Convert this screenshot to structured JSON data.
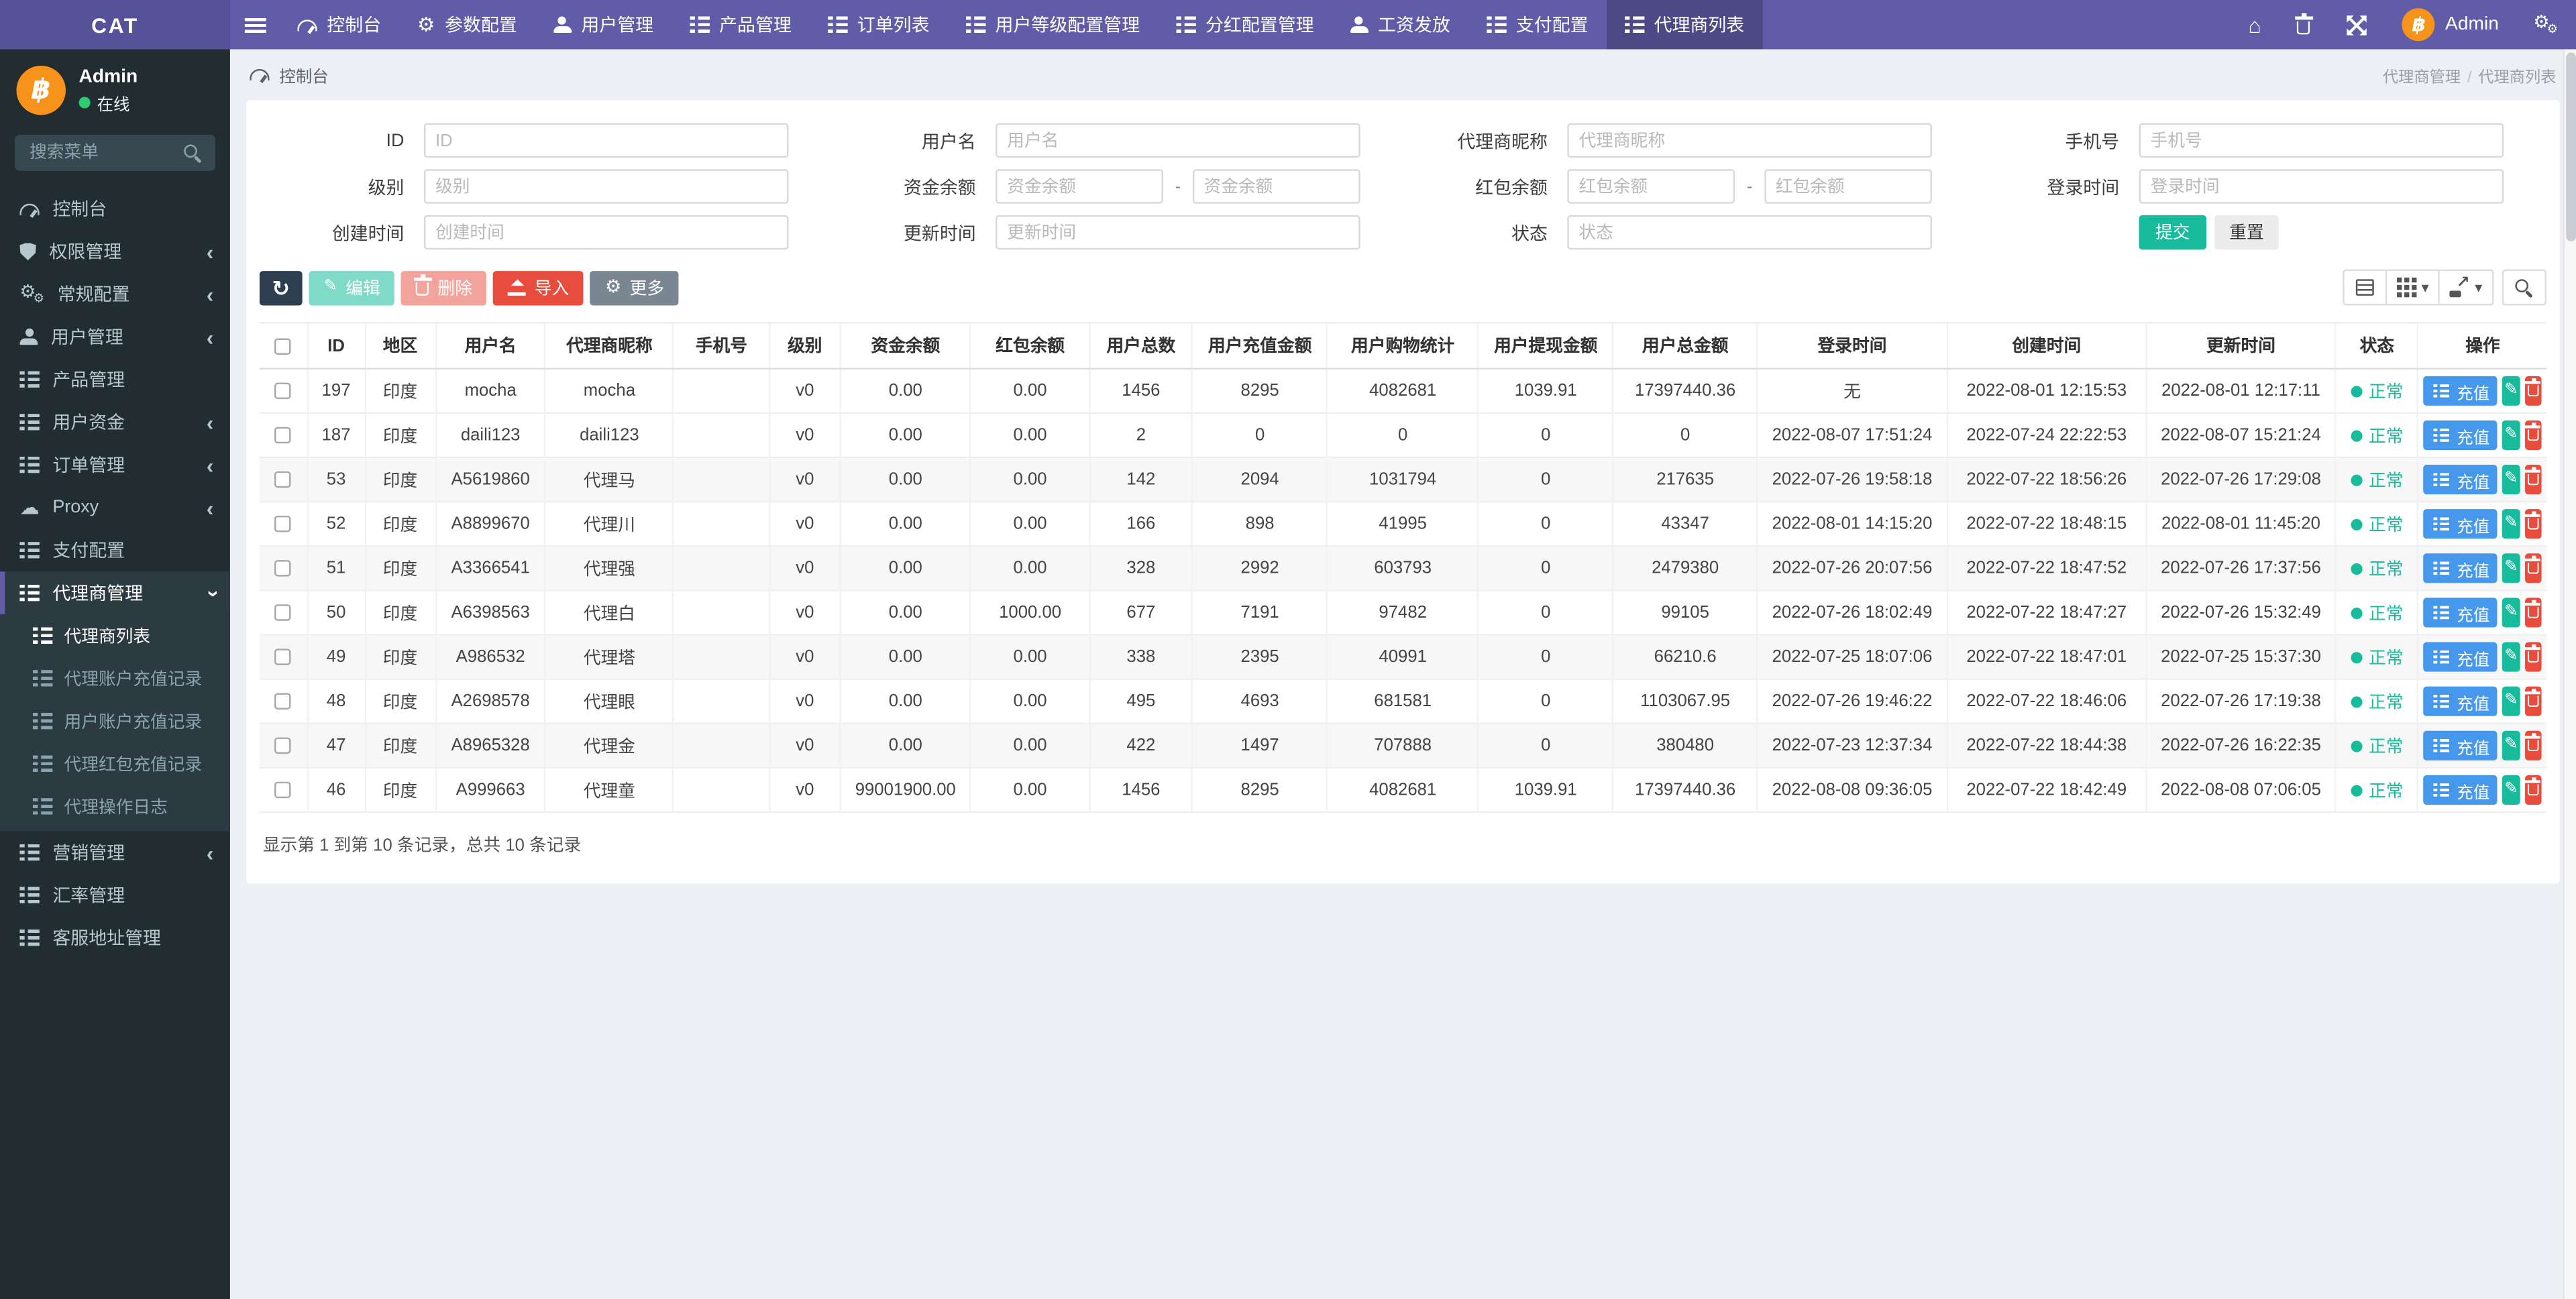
{
  "brand": "CAT",
  "colors": {
    "accent_purple": "#605ca8",
    "logo_purple": "#555299",
    "sidebar_dark": "#222d32",
    "content_bg": "#ecf0f5",
    "teal": "#18bc9c",
    "red": "#e74c3c",
    "blue": "#4598eb",
    "dark_navy": "#2c3e50",
    "avatar_orange": "#f7931a",
    "online_green": "#2ecc71"
  },
  "topnav": {
    "user_name": "Admin",
    "avatar_glyph": "฿",
    "items": [
      {
        "label": "控制台",
        "icon": "dashboard-icon"
      },
      {
        "label": "参数配置",
        "icon": "gear-icon"
      },
      {
        "label": "用户管理",
        "icon": "user-icon"
      },
      {
        "label": "产品管理",
        "icon": "list-icon"
      },
      {
        "label": "订单列表",
        "icon": "list-icon"
      },
      {
        "label": "用户等级配置管理",
        "icon": "list-icon"
      },
      {
        "label": "分红配置管理",
        "icon": "list-icon"
      },
      {
        "label": "工资发放",
        "icon": "user-icon"
      },
      {
        "label": "支付配置",
        "icon": "list-icon"
      },
      {
        "label": "代理商列表",
        "icon": "list-icon",
        "active": true
      }
    ]
  },
  "sidebar": {
    "user_name": "Admin",
    "avatar_glyph": "฿",
    "status_label": "在线",
    "search_placeholder": "搜索菜单",
    "menu": [
      {
        "label": "控制台",
        "icon": "dashboard-icon"
      },
      {
        "label": "权限管理",
        "icon": "shield-icon",
        "chevron": "left"
      },
      {
        "label": "常规配置",
        "icon": "cogs-icon",
        "chevron": "left"
      },
      {
        "label": "用户管理",
        "icon": "user-icon",
        "chevron": "left"
      },
      {
        "label": "产品管理",
        "icon": "list-icon"
      },
      {
        "label": "用户资金",
        "icon": "list-icon",
        "chevron": "left"
      },
      {
        "label": "订单管理",
        "icon": "list-icon",
        "chevron": "left"
      },
      {
        "label": "Proxy",
        "icon": "cloud-icon",
        "chevron": "left"
      },
      {
        "label": "支付配置",
        "icon": "list-icon"
      },
      {
        "label": "代理商管理",
        "icon": "list-icon",
        "chevron": "down",
        "active": true,
        "children": [
          {
            "label": "代理商列表",
            "active": true
          },
          {
            "label": "代理账户充值记录"
          },
          {
            "label": "用户账户充值记录"
          },
          {
            "label": "代理红包充值记录"
          },
          {
            "label": "代理操作日志"
          }
        ]
      },
      {
        "label": "营销管理",
        "icon": "list-icon",
        "chevron": "left"
      },
      {
        "label": "汇率管理",
        "icon": "list-icon"
      },
      {
        "label": "客服地址管理",
        "icon": "list-icon"
      }
    ]
  },
  "breadcrumb": {
    "home_label": "控制台",
    "separator": "/",
    "path": [
      "代理商管理",
      "代理商列表"
    ]
  },
  "filters": {
    "range_separator": "-",
    "submit_label": "提交",
    "reset_label": "重置",
    "fields": [
      {
        "label": "ID",
        "type": "text",
        "placeholder": "ID"
      },
      {
        "label": "用户名",
        "type": "text",
        "placeholder": "用户名"
      },
      {
        "label": "代理商昵称",
        "type": "text",
        "placeholder": "代理商昵称"
      },
      {
        "label": "手机号",
        "type": "text",
        "placeholder": "手机号"
      },
      {
        "label": "级别",
        "type": "text",
        "placeholder": "级别"
      },
      {
        "label": "资金余额",
        "type": "range",
        "placeholder_min": "资金余额",
        "placeholder_max": "资金余额"
      },
      {
        "label": "红包余额",
        "type": "range",
        "placeholder_min": "红包余额",
        "placeholder_max": "红包余额"
      },
      {
        "label": "登录时间",
        "type": "text",
        "placeholder": "登录时间"
      },
      {
        "label": "创建时间",
        "type": "text",
        "placeholder": "创建时间"
      },
      {
        "label": "更新时间",
        "type": "text",
        "placeholder": "更新时间"
      },
      {
        "label": "状态",
        "type": "text",
        "placeholder": "状态"
      }
    ]
  },
  "toolbar": {
    "edit_label": "编辑",
    "delete_label": "删除",
    "import_label": "导入",
    "more_label": "更多"
  },
  "table": {
    "recharge_label": "充值",
    "headers": [
      "ID",
      "地区",
      "用户名",
      "代理商昵称",
      "手机号",
      "级别",
      "资金余额",
      "红包余额",
      "用户总数",
      "用户充值金额",
      "用户购物统计",
      "用户提现金额",
      "用户总金额",
      "登录时间",
      "创建时间",
      "更新时间",
      "状态",
      "操作"
    ],
    "rows": [
      {
        "id": "197",
        "region": "印度",
        "username": "mocha",
        "nickname": "mocha",
        "phone": "",
        "level": "v0",
        "fund": "0.00",
        "red": "0.00",
        "users": "1456",
        "recharge": "8295",
        "shopping": "4082681",
        "withdraw": "1039.91",
        "total": "17397440.36",
        "login": "无",
        "created": "2022-08-01 12:15:53",
        "updated": "2022-08-01 12:17:11",
        "status": "正常"
      },
      {
        "id": "187",
        "region": "印度",
        "username": "daili123",
        "nickname": "daili123",
        "phone": "",
        "level": "v0",
        "fund": "0.00",
        "red": "0.00",
        "users": "2",
        "recharge": "0",
        "shopping": "0",
        "withdraw": "0",
        "total": "0",
        "login": "2022-08-07 17:51:24",
        "created": "2022-07-24 22:22:53",
        "updated": "2022-08-07 15:21:24",
        "status": "正常"
      },
      {
        "id": "53",
        "region": "印度",
        "username": "A5619860",
        "nickname": "代理马",
        "phone": "",
        "level": "v0",
        "fund": "0.00",
        "red": "0.00",
        "users": "142",
        "recharge": "2094",
        "shopping": "1031794",
        "withdraw": "0",
        "total": "217635",
        "login": "2022-07-26 19:58:18",
        "created": "2022-07-22 18:56:26",
        "updated": "2022-07-26 17:29:08",
        "status": "正常"
      },
      {
        "id": "52",
        "region": "印度",
        "username": "A8899670",
        "nickname": "代理川",
        "phone": "",
        "level": "v0",
        "fund": "0.00",
        "red": "0.00",
        "users": "166",
        "recharge": "898",
        "shopping": "41995",
        "withdraw": "0",
        "total": "43347",
        "login": "2022-08-01 14:15:20",
        "created": "2022-07-22 18:48:15",
        "updated": "2022-08-01 11:45:20",
        "status": "正常"
      },
      {
        "id": "51",
        "region": "印度",
        "username": "A3366541",
        "nickname": "代理强",
        "phone": "",
        "level": "v0",
        "fund": "0.00",
        "red": "0.00",
        "users": "328",
        "recharge": "2992",
        "shopping": "603793",
        "withdraw": "0",
        "total": "2479380",
        "login": "2022-07-26 20:07:56",
        "created": "2022-07-22 18:47:52",
        "updated": "2022-07-26 17:37:56",
        "status": "正常"
      },
      {
        "id": "50",
        "region": "印度",
        "username": "A6398563",
        "nickname": "代理白",
        "phone": "",
        "level": "v0",
        "fund": "0.00",
        "red": "1000.00",
        "users": "677",
        "recharge": "7191",
        "shopping": "97482",
        "withdraw": "0",
        "total": "99105",
        "login": "2022-07-26 18:02:49",
        "created": "2022-07-22 18:47:27",
        "updated": "2022-07-26 15:32:49",
        "status": "正常"
      },
      {
        "id": "49",
        "region": "印度",
        "username": "A986532",
        "nickname": "代理塔",
        "phone": "",
        "level": "v0",
        "fund": "0.00",
        "red": "0.00",
        "users": "338",
        "recharge": "2395",
        "shopping": "40991",
        "withdraw": "0",
        "total": "66210.6",
        "login": "2022-07-25 18:07:06",
        "created": "2022-07-22 18:47:01",
        "updated": "2022-07-25 15:37:30",
        "status": "正常"
      },
      {
        "id": "48",
        "region": "印度",
        "username": "A2698578",
        "nickname": "代理眼",
        "phone": "",
        "level": "v0",
        "fund": "0.00",
        "red": "0.00",
        "users": "495",
        "recharge": "4693",
        "shopping": "681581",
        "withdraw": "0",
        "total": "1103067.95",
        "login": "2022-07-26 19:46:22",
        "created": "2022-07-22 18:46:06",
        "updated": "2022-07-26 17:19:38",
        "status": "正常"
      },
      {
        "id": "47",
        "region": "印度",
        "username": "A8965328",
        "nickname": "代理金",
        "phone": "",
        "level": "v0",
        "fund": "0.00",
        "red": "0.00",
        "users": "422",
        "recharge": "1497",
        "shopping": "707888",
        "withdraw": "0",
        "total": "380480",
        "login": "2022-07-23 12:37:34",
        "created": "2022-07-22 18:44:38",
        "updated": "2022-07-26 16:22:35",
        "status": "正常"
      },
      {
        "id": "46",
        "region": "印度",
        "username": "A999663",
        "nickname": "代理童",
        "phone": "",
        "level": "v0",
        "fund": "99001900.00",
        "red": "0.00",
        "users": "1456",
        "recharge": "8295",
        "shopping": "4082681",
        "withdraw": "1039.91",
        "total": "17397440.36",
        "login": "2022-08-08 09:36:05",
        "created": "2022-07-22 18:42:49",
        "updated": "2022-08-08 07:06:05",
        "status": "正常"
      }
    ]
  },
  "footer": {
    "summary": "显示第 1 到第 10 条记录，总共 10 条记录"
  }
}
